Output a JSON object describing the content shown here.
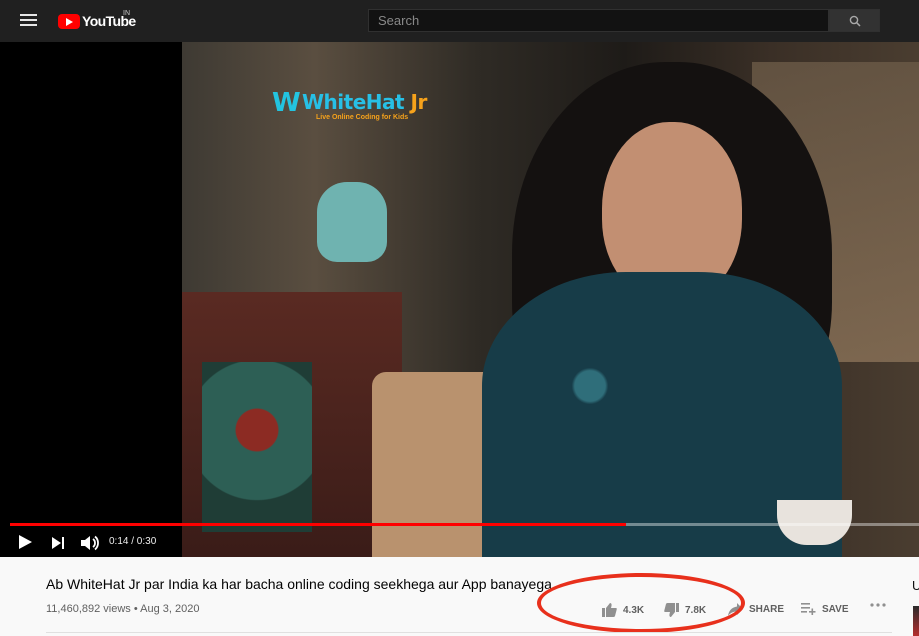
{
  "header": {
    "logo_text": "YouTube",
    "country_code": "IN",
    "search_placeholder": "Search"
  },
  "video": {
    "brand_name": "WhiteHat",
    "brand_suffix": "Jr",
    "brand_tagline": "Live Online Coding for Kids",
    "time_display": "0:14 / 0:30",
    "progress_fraction": 0.678
  },
  "info": {
    "title": "Ab WhiteHat Jr par India ka har bacha online coding seekhega aur App banayega",
    "views_and_date": "11,460,892 views • Aug 3, 2020",
    "like_count": "4.3K",
    "dislike_count": "7.8K",
    "share_label": "SHARE",
    "save_label": "SAVE",
    "sidebar_partial_letter": "U"
  },
  "colors": {
    "accent": "#ff0000",
    "highlight_annotation": "#e8301c"
  }
}
